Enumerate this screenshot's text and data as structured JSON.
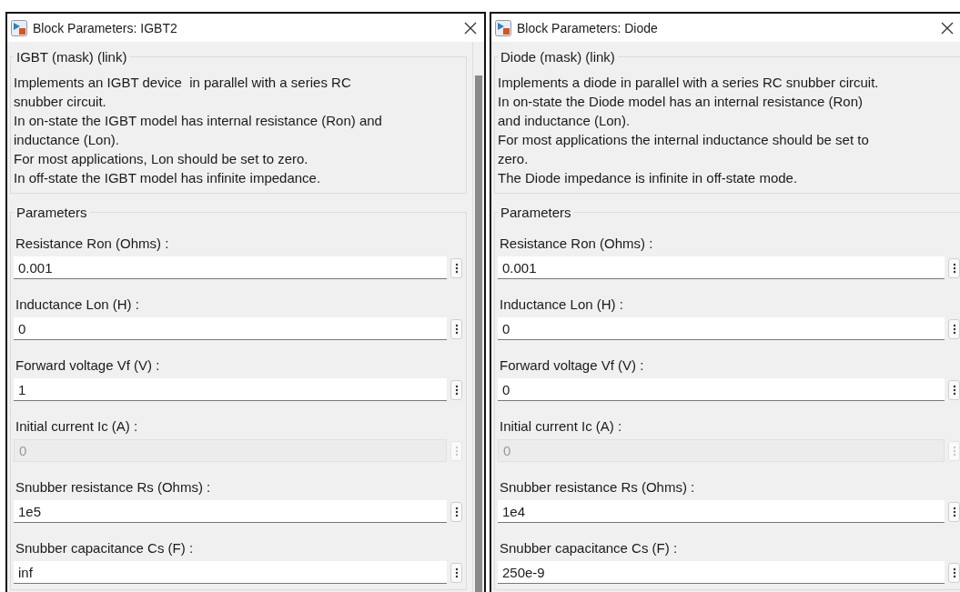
{
  "dialogs": [
    {
      "title": "Block Parameters: IGBT2",
      "mask_title": "IGBT (mask) (link)",
      "scrollbar": true,
      "description": [
        "Implements an IGBT device  in parallel with a series RC",
        "snubber circuit.",
        "In on-state the IGBT model has internal resistance (Ron) and",
        "inductance (Lon).",
        "For most applications, Lon should be set to zero.",
        "In off-state the IGBT model has infinite impedance."
      ],
      "group_title": "Parameters",
      "parameters": [
        {
          "label": "Resistance Ron (Ohms) :",
          "value": "0.001",
          "disabled": false
        },
        {
          "label": "Inductance Lon (H) :",
          "value": "0",
          "disabled": false
        },
        {
          "label": "Forward voltage Vf (V) :",
          "value": "1",
          "disabled": false
        },
        {
          "label": "Initial current Ic (A) :",
          "value": "0",
          "disabled": true
        },
        {
          "label": "Snubber resistance Rs (Ohms) :",
          "value": "1e5",
          "disabled": false
        },
        {
          "label": "Snubber capacitance Cs (F) :",
          "value": "inf",
          "disabled": false
        }
      ]
    },
    {
      "title": "Block Parameters: Diode",
      "mask_title": "Diode (mask) (link)",
      "scrollbar": false,
      "description": [
        "Implements a diode in parallel with a series RC snubber circuit.",
        "In on-state the Diode model has an internal resistance (Ron)",
        "and inductance (Lon).",
        "For most applications the internal inductance should be set to",
        "zero.",
        "The Diode impedance is infinite in off-state mode."
      ],
      "group_title": "Parameters",
      "parameters": [
        {
          "label": "Resistance Ron (Ohms) :",
          "value": "0.001",
          "disabled": false
        },
        {
          "label": "Inductance Lon (H) :",
          "value": "0",
          "disabled": false
        },
        {
          "label": "Forward voltage Vf (V) :",
          "value": "0",
          "disabled": false
        },
        {
          "label": "Initial current Ic (A) :",
          "value": "0",
          "disabled": true
        },
        {
          "label": "Snubber resistance Rs (Ohms) :",
          "value": "1e4",
          "disabled": false
        },
        {
          "label": "Snubber capacitance Cs (F) :",
          "value": "250e-9",
          "disabled": false
        }
      ]
    }
  ]
}
